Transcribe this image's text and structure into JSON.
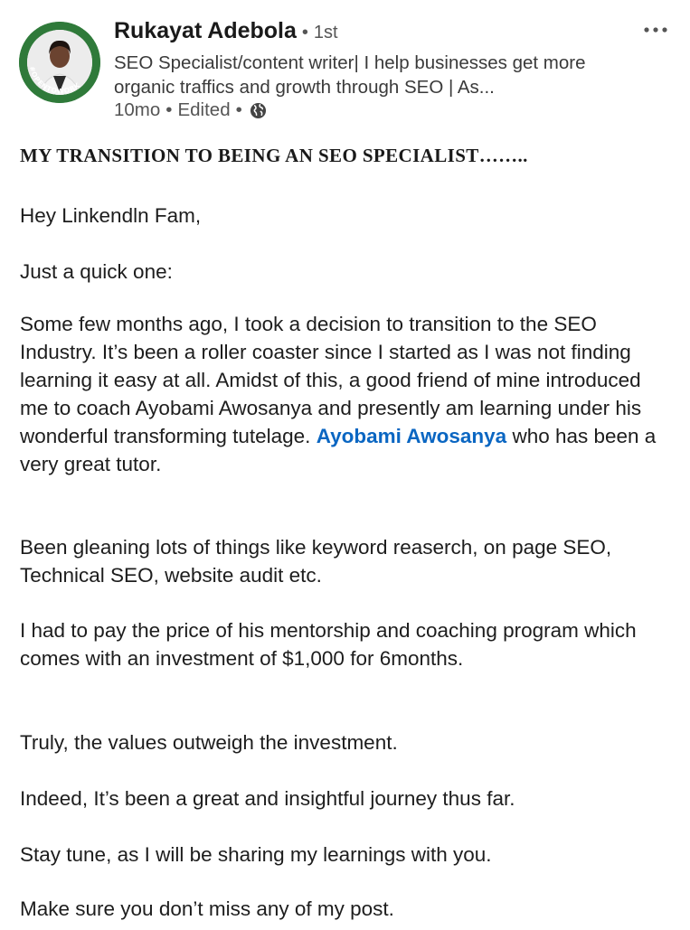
{
  "author": {
    "name": "Rukayat Adebola",
    "separator": "•",
    "degree": "1st",
    "headline": "SEO Specialist/content writer| I help businesses get more organic traffics and growth through SEO | As...",
    "time": "10mo",
    "dot": "•",
    "edited": "Edited",
    "dot2": "•",
    "avatar_badge": "#OPENTOWORK"
  },
  "menu": {
    "icon": "more-horizontal-icon"
  },
  "post": {
    "title": "MY TRANSITION TO BEING AN SEO SPECIALIST……..",
    "greeting": "Hey Linkendln Fam,",
    "intro": "Just a quick one:",
    "p1_text": "Some few months ago, I took a decision to transition to the SEO Industry. It’s been a roller coaster since I started as I was not finding learning it easy at all. Amidst of this, a good friend of mine introduced me to coach Ayobami Awosanya and presently am learning under his wonderful transforming tutelage. ",
    "p1_mention": "Ayobami Awosanya",
    "p1_after": "  who has been a very great tutor.",
    "p2": "Been gleaning lots of things like keyword reaserch, on page SEO, Technical SEO, website audit etc.",
    "p3": "I had to pay the price of his mentorship and coaching program which comes with an investment of $1,000 for 6months.",
    "p4": "Truly, the values outweigh the investment.",
    "p5": "Indeed, It’s been a great and insightful journey thus far.",
    "p6": "Stay tune, as I will be sharing my learnings with you.",
    "p7": "Make sure you don’t miss any of my post."
  },
  "colors": {
    "mention": "#0a66c2",
    "open_to_work_ring": "#2f7a3a"
  }
}
